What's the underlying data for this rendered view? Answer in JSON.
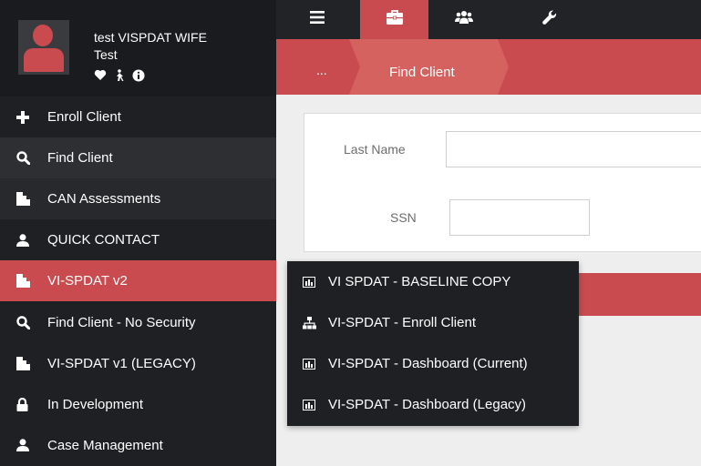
{
  "user": {
    "name": "test VISPDAT WIFE",
    "subname": "Test",
    "icons": [
      "heart-icon",
      "person-walking-icon",
      "info-icon"
    ]
  },
  "topbar": {
    "buttons": [
      "menu-icon",
      "briefcase-icon",
      "users-icon",
      "wrench-icon"
    ],
    "active": "briefcase-icon"
  },
  "breadcrumb": {
    "root": "...",
    "current": "Find Client"
  },
  "sidebar": {
    "items": [
      {
        "label": "Enroll Client",
        "icon": "plus-icon"
      },
      {
        "label": "Find Client",
        "icon": "search-icon"
      },
      {
        "label": "CAN Assessments",
        "icon": "document-icon"
      },
      {
        "label": "QUICK CONTACT",
        "icon": "user-icon"
      },
      {
        "label": "VI-SPDAT v2",
        "icon": "document-icon"
      },
      {
        "label": "Find Client - No Security",
        "icon": "search-icon"
      },
      {
        "label": "VI-SPDAT v1 (LEGACY)",
        "icon": "document-icon"
      },
      {
        "label": "In Development",
        "icon": "lock-icon"
      },
      {
        "label": "Case Management",
        "icon": "user-icon"
      }
    ],
    "active": "VI-SPDAT v2"
  },
  "form": {
    "last_name_label": "Last Name",
    "last_name_value": "",
    "ssn_label": "SSN",
    "ssn_value": ""
  },
  "dropdown": {
    "items": [
      {
        "label": "VI SPDAT - BASELINE COPY",
        "icon": "bar-chart-icon"
      },
      {
        "label": "VI-SPDAT - Enroll Client",
        "icon": "sitemap-icon"
      },
      {
        "label": "VI-SPDAT - Dashboard (Current)",
        "icon": "bar-chart-icon"
      },
      {
        "label": "VI-SPDAT - Dashboard (Legacy)",
        "icon": "bar-chart-icon"
      }
    ]
  },
  "colors": {
    "accent": "#c94b4f",
    "sidebar": "#1f2023",
    "topbar": "#222326",
    "background": "#eeeeee"
  }
}
